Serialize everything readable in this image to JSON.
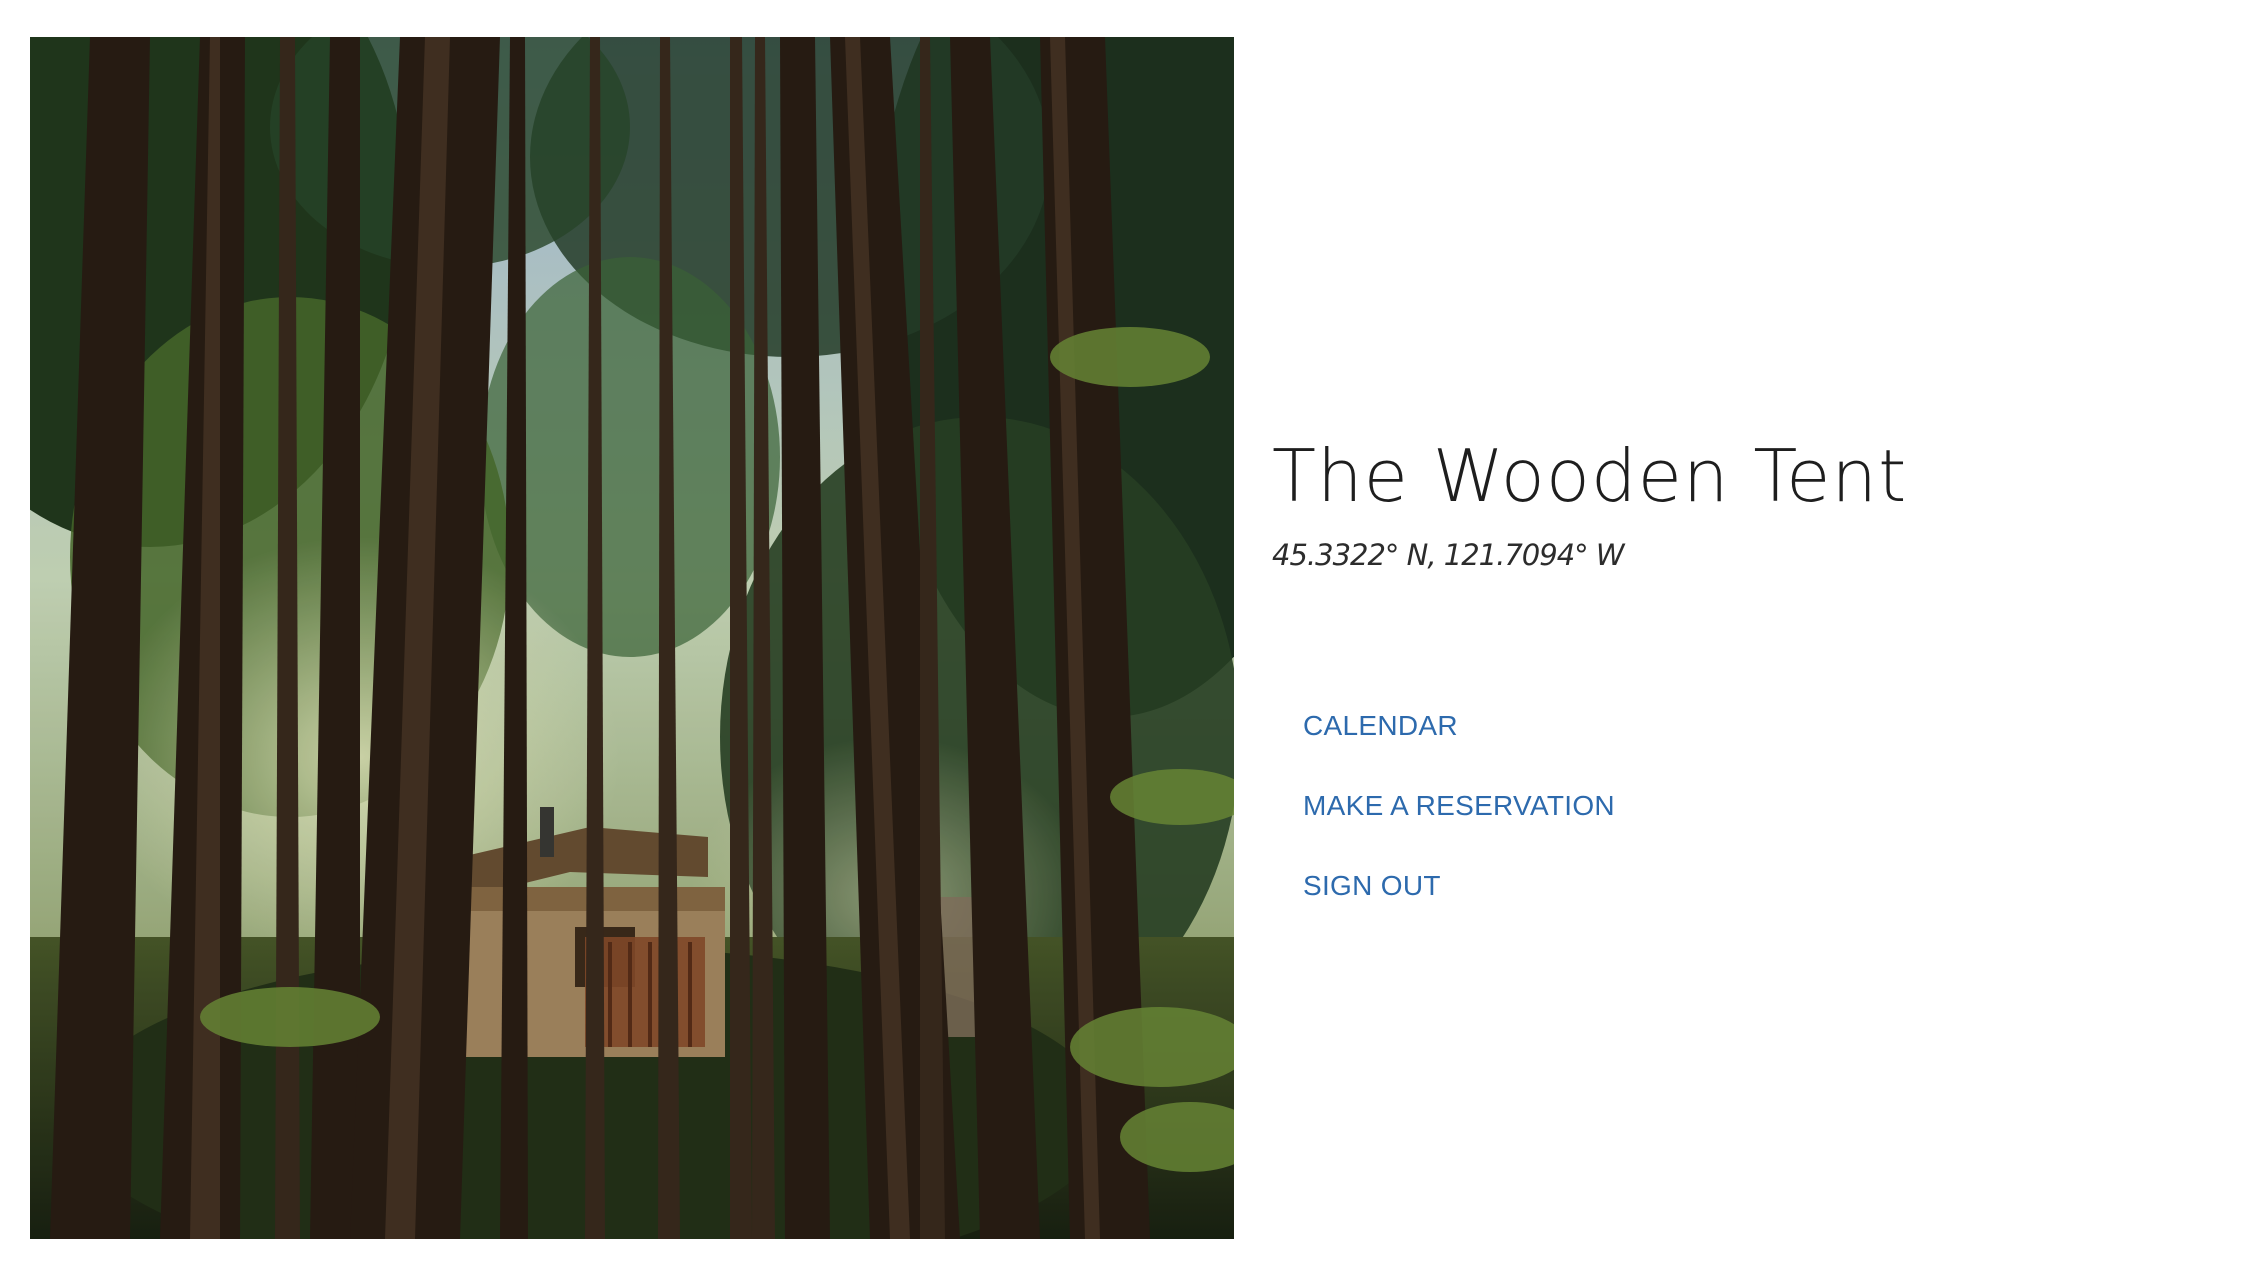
{
  "hero_image": {
    "subject": "cabin-in-forest-photo"
  },
  "site": {
    "title": "The Wooden Tent",
    "coordinates": "45.3322° N, 121.7094° W"
  },
  "nav": {
    "calendar": "CALENDAR",
    "reservation": "MAKE A RESERVATION",
    "sign_out": "SIGN OUT"
  },
  "colors": {
    "link": "#2d6aad",
    "title": "#1e1e1e",
    "background": "#ffffff"
  }
}
